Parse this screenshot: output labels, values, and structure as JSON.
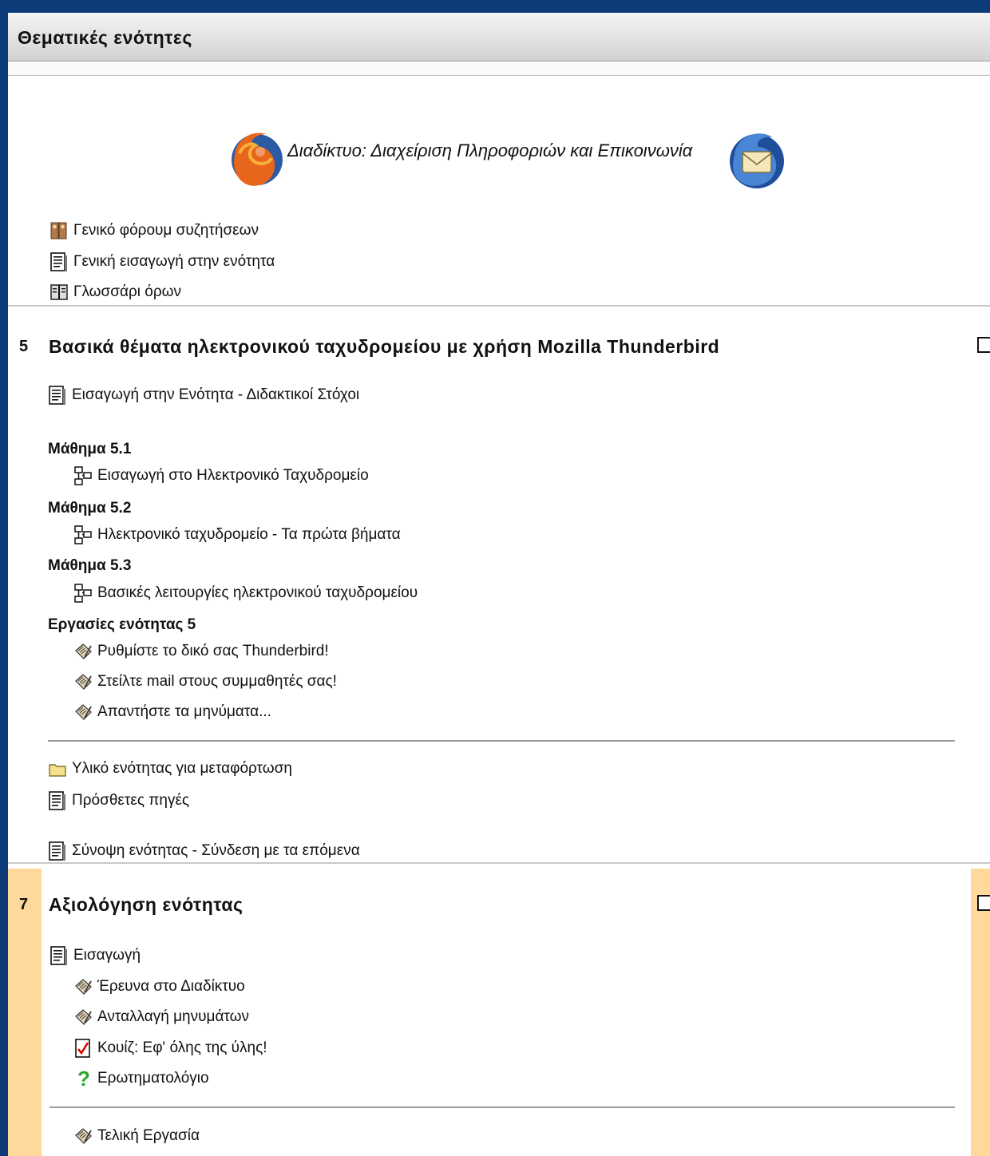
{
  "header": {
    "title": "Θεματικές ενότητες"
  },
  "top_section": {
    "course_title": "Διαδίκτυο: Διαχείριση Πληροφοριών και Επικοινωνία",
    "items": [
      {
        "icon": "forum-icon",
        "label": "Γενικό φόρουμ συζητήσεων"
      },
      {
        "icon": "page-icon",
        "label": "Γενική εισαγωγή στην ενότητα"
      },
      {
        "icon": "glossary-icon",
        "label": "Γλωσσάρι όρων"
      }
    ]
  },
  "section5": {
    "number": "5",
    "title": "Βασικά θέματα ηλεκτρονικού ταχυδρομείου με χρήση Mozilla Thunderbird",
    "intro": "Εισαγωγή στην Ενότητα - Διδακτικοί Στόχοι",
    "lessons": [
      {
        "heading": "Μάθημα 5.1",
        "item": "Εισαγωγή στο Ηλεκτρονικό Ταχυδρομείο"
      },
      {
        "heading": "Μάθημα 5.2",
        "item": "Ηλεκτρονικό ταχυδρομείο - Τα πρώτα βήματα"
      },
      {
        "heading": "Μάθημα 5.3",
        "item": "Βασικές λειτουργίες ηλεκτρονικού ταχυδρομείου"
      }
    ],
    "tasks_heading": "Εργασίες ενότητας 5",
    "tasks": [
      "Ρυθμίστε το δικό σας Thunderbird!",
      "Στείλτε mail στους συμμαθητές σας!",
      "Απαντήστε τα μηνύματα..."
    ],
    "materials": [
      {
        "icon": "folder-icon",
        "label": "Υλικό ενότητας για μεταφόρτωση"
      },
      {
        "icon": "page-icon",
        "label": "Πρόσθετες πηγές"
      }
    ],
    "summary": "Σύνοψη ενότητας - Σύνδεση με τα επόμενα"
  },
  "section7": {
    "number": "7",
    "title": "Αξιολόγηση ενότητας",
    "intro": "Εισαγωγή",
    "items": [
      {
        "icon": "assignment-icon",
        "label": "Έρευνα στο Διαδίκτυο"
      },
      {
        "icon": "assignment-icon",
        "label": "Ανταλλαγή μηνυμάτων"
      },
      {
        "icon": "quiz-icon",
        "label": "Κουίζ: Εφ' όλης της ύλης!"
      },
      {
        "icon": "questionnaire-icon",
        "label": "Ερωτηματολόγιο"
      }
    ],
    "final": "Τελική Εργασία"
  },
  "colors": {
    "frame": "#0d3a78",
    "highlight": "#ffd99b"
  }
}
